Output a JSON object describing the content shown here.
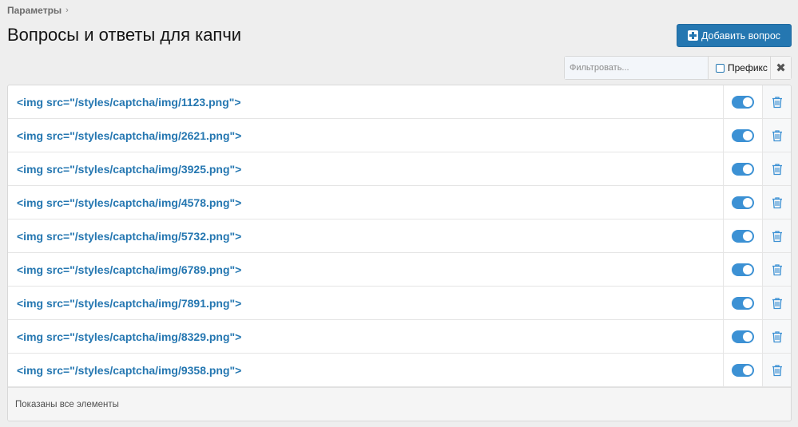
{
  "breadcrumb": {
    "label": "Параметры",
    "chevron": "›"
  },
  "page": {
    "title": "Вопросы и ответы для капчи"
  },
  "toolbar": {
    "add_label": "Добавить вопрос",
    "add_icon": "plus-square-icon"
  },
  "filter": {
    "placeholder": "Фильтровать...",
    "prefix_label": "Префикс",
    "clear_glyph": "✖"
  },
  "colors": {
    "accent": "#2577b1",
    "toggle_on": "#3c91d4"
  },
  "rows": [
    {
      "label": "<img src=\"/styles/captcha/img/1123.png\">",
      "enabled": true
    },
    {
      "label": "<img src=\"/styles/captcha/img/2621.png\">",
      "enabled": true
    },
    {
      "label": "<img src=\"/styles/captcha/img/3925.png\">",
      "enabled": true
    },
    {
      "label": "<img src=\"/styles/captcha/img/4578.png\">",
      "enabled": true
    },
    {
      "label": "<img src=\"/styles/captcha/img/5732.png\">",
      "enabled": true
    },
    {
      "label": "<img src=\"/styles/captcha/img/6789.png\">",
      "enabled": true
    },
    {
      "label": "<img src=\"/styles/captcha/img/7891.png\">",
      "enabled": true
    },
    {
      "label": "<img src=\"/styles/captcha/img/8329.png\">",
      "enabled": true
    },
    {
      "label": "<img src=\"/styles/captcha/img/9358.png\">",
      "enabled": true
    }
  ],
  "footer": {
    "text": "Показаны все элементы"
  }
}
